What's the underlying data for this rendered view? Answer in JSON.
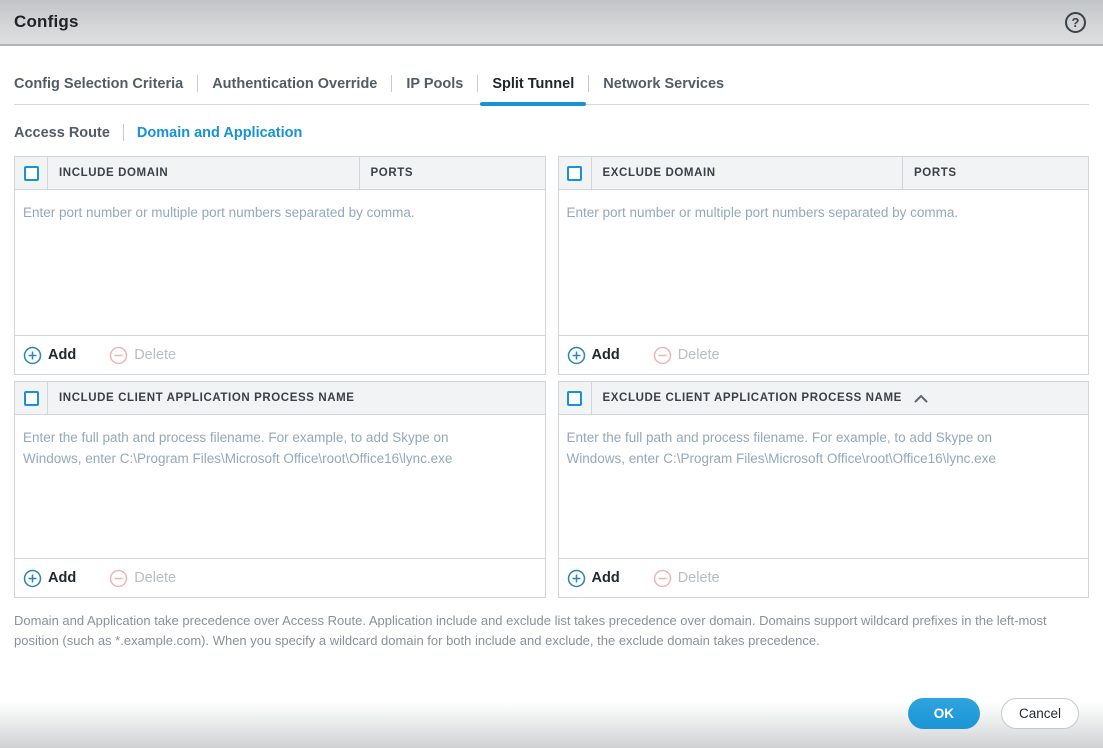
{
  "window": {
    "title": "Configs",
    "help_glyph": "?"
  },
  "tabs": [
    {
      "label": "Config Selection Criteria",
      "active": false
    },
    {
      "label": "Authentication Override",
      "active": false
    },
    {
      "label": "IP Pools",
      "active": false
    },
    {
      "label": "Split Tunnel",
      "active": true
    },
    {
      "label": "Network Services",
      "active": false
    }
  ],
  "subtabs": [
    {
      "label": "Access Route",
      "active": false
    },
    {
      "label": "Domain and Application",
      "active": true
    }
  ],
  "panels": [
    {
      "headers": [
        "INCLUDE DOMAIN",
        "PORTS"
      ],
      "placeholder": "Enter port number or multiple port numbers separated by comma.",
      "add_label": "Add",
      "delete_label": "Delete"
    },
    {
      "headers": [
        "EXCLUDE DOMAIN",
        "PORTS"
      ],
      "placeholder": "Enter port number or multiple port numbers separated by comma.",
      "add_label": "Add",
      "delete_label": "Delete"
    },
    {
      "headers": [
        "INCLUDE CLIENT APPLICATION PROCESS NAME"
      ],
      "placeholder": "Enter the full path and process filename. For example, to add Skype on Windows, enter C:\\Program Files\\Microsoft Office\\root\\Office16\\lync.exe",
      "add_label": "Add",
      "delete_label": "Delete"
    },
    {
      "headers": [
        "EXCLUDE CLIENT APPLICATION PROCESS NAME"
      ],
      "collapsed_indicator": "chevron-up",
      "placeholder": "Enter the full path and process filename. For example, to add Skype on Windows, enter C:\\Program Files\\Microsoft Office\\root\\Office16\\lync.exe",
      "add_label": "Add",
      "delete_label": "Delete"
    }
  ],
  "footnote": {
    "text": "Domain and Application take precedence over Access Route. Application include and exclude list takes precedence over domain. Domains support wildcard prefixes in the left-most position (such as *.example.com). When you specify a wildcard domain for both include and exclude, the exclude domain takes precedence."
  },
  "actions": {
    "ok_label": "OK",
    "cancel_label": "Cancel"
  },
  "colors": {
    "accent_blue": "#1793d4",
    "active_link_blue": "#1493d6",
    "ok_button_blue": "#1b95d6",
    "delete_icon_pink": "#eeb4b7",
    "add_icon_blue": "#2a84b5",
    "header_bg": "#f2f3f4",
    "placeholder_text": "#93a9b8"
  }
}
